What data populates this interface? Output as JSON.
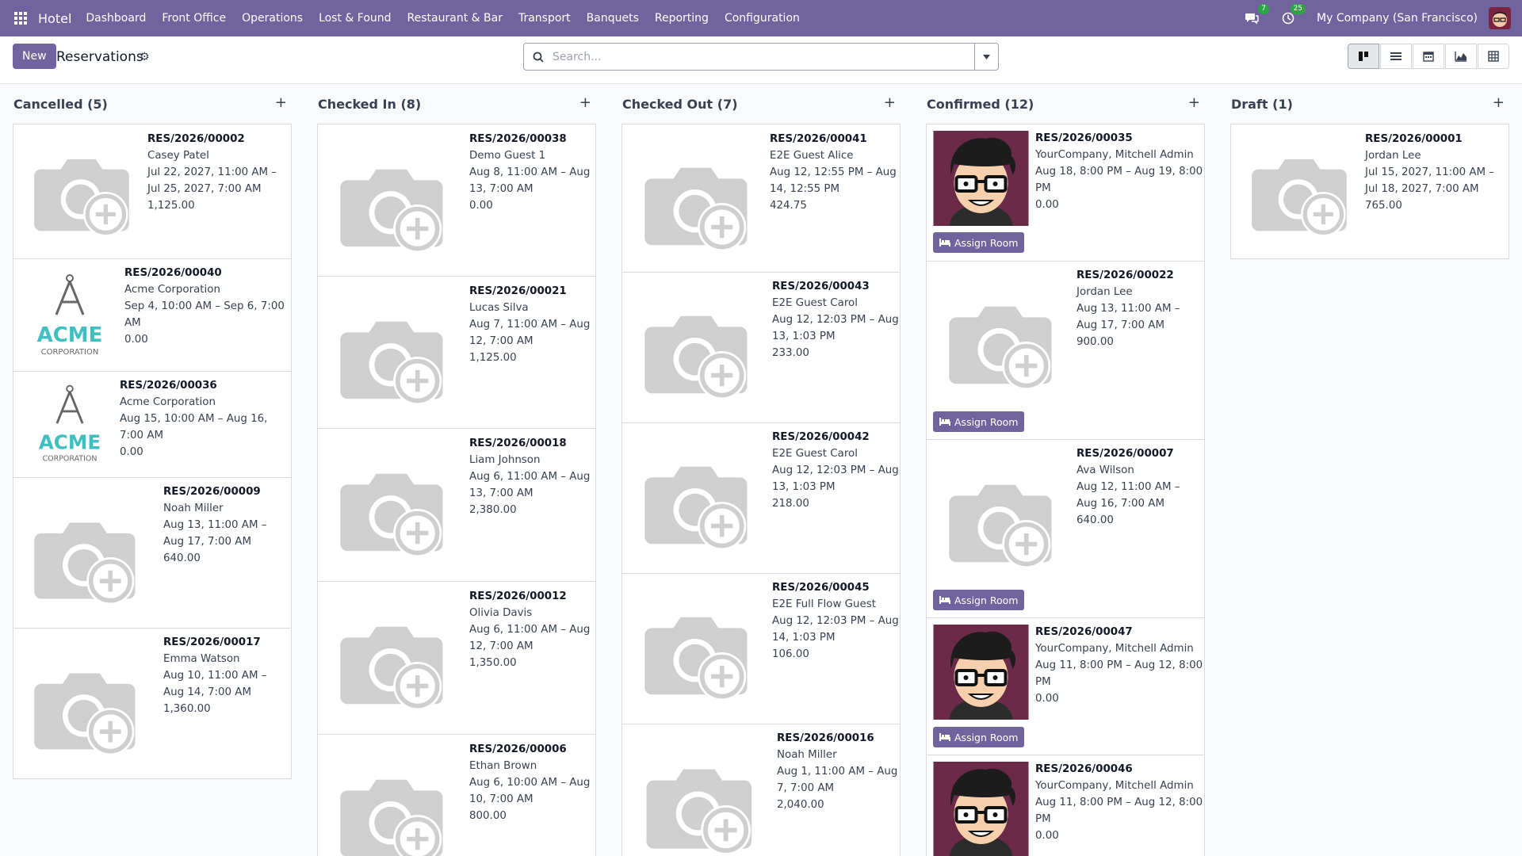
{
  "navbar": {
    "app_name": "Hotel",
    "menu": [
      "Dashboard",
      "Front Office",
      "Operations",
      "Lost & Found",
      "Restaurant & Bar",
      "Transport",
      "Banquets",
      "Reporting",
      "Configuration"
    ],
    "messages_count": "7",
    "activities_count": "25",
    "company": "My Company (San Francisco)"
  },
  "control": {
    "new_label": "New",
    "title": "Reservations",
    "search_placeholder": "Search..."
  },
  "colors": {
    "primary": "#71639e",
    "card_border": "#d8dadd",
    "badge": "#28a745"
  },
  "columns": [
    {
      "title": "Cancelled (5)",
      "cards": [
        {
          "ref": "RES/2026/00002",
          "guest": "Casey Patel",
          "dates": "Jul 22, 2027, 11:00 AM – Jul 25, 2027, 7:00 AM",
          "amount": "1,125.00",
          "image": "placeholder"
        },
        {
          "ref": "RES/2026/00040",
          "guest": "Acme Corporation",
          "dates": "Sep 4, 10:00 AM – Sep 6, 7:00 AM",
          "amount": "0.00",
          "image": "acme",
          "logo_main": "ACME",
          "logo_sub": "CORPORATION"
        },
        {
          "ref": "RES/2026/00036",
          "guest": "Acme Corporation",
          "dates": "Aug 15, 10:00 AM – Aug 16, 7:00 AM",
          "amount": "0.00",
          "image": "acme",
          "logo_main": "ACME",
          "logo_sub": "CORPORATION"
        },
        {
          "ref": "RES/2026/00009",
          "guest": "Noah Miller",
          "dates": "Aug 13, 11:00 AM – Aug 17, 7:00 AM",
          "amount": "640.00",
          "image": "placeholder"
        },
        {
          "ref": "RES/2026/00017",
          "guest": "Emma Watson",
          "dates": "Aug 10, 11:00 AM – Aug 14, 7:00 AM",
          "amount": "1,360.00",
          "image": "placeholder"
        }
      ]
    },
    {
      "title": "Checked In (8)",
      "cards": [
        {
          "ref": "RES/2026/00038",
          "guest": "Demo Guest 1",
          "dates": "Aug 8, 11:00 AM – Aug 13, 7:00 AM",
          "amount": "0.00",
          "image": "placeholder"
        },
        {
          "ref": "RES/2026/00021",
          "guest": "Lucas Silva",
          "dates": "Aug 7, 11:00 AM – Aug 12, 7:00 AM",
          "amount": "1,125.00",
          "image": "placeholder"
        },
        {
          "ref": "RES/2026/00018",
          "guest": "Liam Johnson",
          "dates": "Aug 6, 11:00 AM – Aug 13, 7:00 AM",
          "amount": "2,380.00",
          "image": "placeholder"
        },
        {
          "ref": "RES/2026/00012",
          "guest": "Olivia Davis",
          "dates": "Aug 6, 11:00 AM – Aug 12, 7:00 AM",
          "amount": "1,350.00",
          "image": "placeholder"
        },
        {
          "ref": "RES/2026/00006",
          "guest": "Ethan Brown",
          "dates": "Aug 6, 10:00 AM – Aug 10, 7:00 AM",
          "amount": "800.00",
          "image": "placeholder"
        }
      ]
    },
    {
      "title": "Checked Out (7)",
      "cards": [
        {
          "ref": "RES/2026/00041",
          "guest": "E2E Guest Alice",
          "dates": "Aug 12, 12:55 PM – Aug 14, 12:55 PM",
          "amount": "424.75",
          "image": "placeholder"
        },
        {
          "ref": "RES/2026/00043",
          "guest": "E2E Guest Carol",
          "dates": "Aug 12, 12:03 PM – Aug 13, 1:03 PM",
          "amount": "233.00",
          "image": "placeholder"
        },
        {
          "ref": "RES/2026/00042",
          "guest": "E2E Guest Carol",
          "dates": "Aug 12, 12:03 PM – Aug 13, 1:03 PM",
          "amount": "218.00",
          "image": "placeholder"
        },
        {
          "ref": "RES/2026/00045",
          "guest": "E2E Full Flow Guest",
          "dates": "Aug 12, 12:03 PM – Aug 14, 1:03 PM",
          "amount": "106.00",
          "image": "placeholder"
        },
        {
          "ref": "RES/2026/00016",
          "guest": "Noah Miller",
          "dates": "Aug 1, 11:00 AM – Aug 7, 7:00 AM",
          "amount": "2,040.00",
          "image": "placeholder"
        }
      ]
    },
    {
      "title": "Confirmed (12)",
      "cards": [
        {
          "ref": "RES/2026/00035",
          "guest": "YourCompany, Mitchell Admin",
          "dates": "Aug 18, 8:00 PM – Aug 19, 8:00 PM",
          "amount": "0.00",
          "image": "avatar",
          "action": "Assign Room"
        },
        {
          "ref": "RES/2026/00022",
          "guest": "Jordan Lee",
          "dates": "Aug 13, 11:00 AM – Aug 17, 7:00 AM",
          "amount": "900.00",
          "image": "placeholder",
          "action": "Assign Room"
        },
        {
          "ref": "RES/2026/00007",
          "guest": "Ava Wilson",
          "dates": "Aug 12, 11:00 AM – Aug 16, 7:00 AM",
          "amount": "640.00",
          "image": "placeholder",
          "action": "Assign Room"
        },
        {
          "ref": "RES/2026/00047",
          "guest": "YourCompany, Mitchell Admin",
          "dates": "Aug 11, 8:00 PM – Aug 12, 8:00 PM",
          "amount": "0.00",
          "image": "avatar",
          "action": "Assign Room"
        },
        {
          "ref": "RES/2026/00046",
          "guest": "YourCompany, Mitchell Admin",
          "dates": "Aug 11, 8:00 PM – Aug 12, 8:00 PM",
          "amount": "0.00",
          "image": "avatar"
        }
      ]
    },
    {
      "title": "Draft (1)",
      "cards": [
        {
          "ref": "RES/2026/00001",
          "guest": "Jordan Lee",
          "dates": "Jul 15, 2027, 11:00 AM – Jul 18, 2027, 7:00 AM",
          "amount": "765.00",
          "image": "placeholder"
        }
      ]
    }
  ]
}
